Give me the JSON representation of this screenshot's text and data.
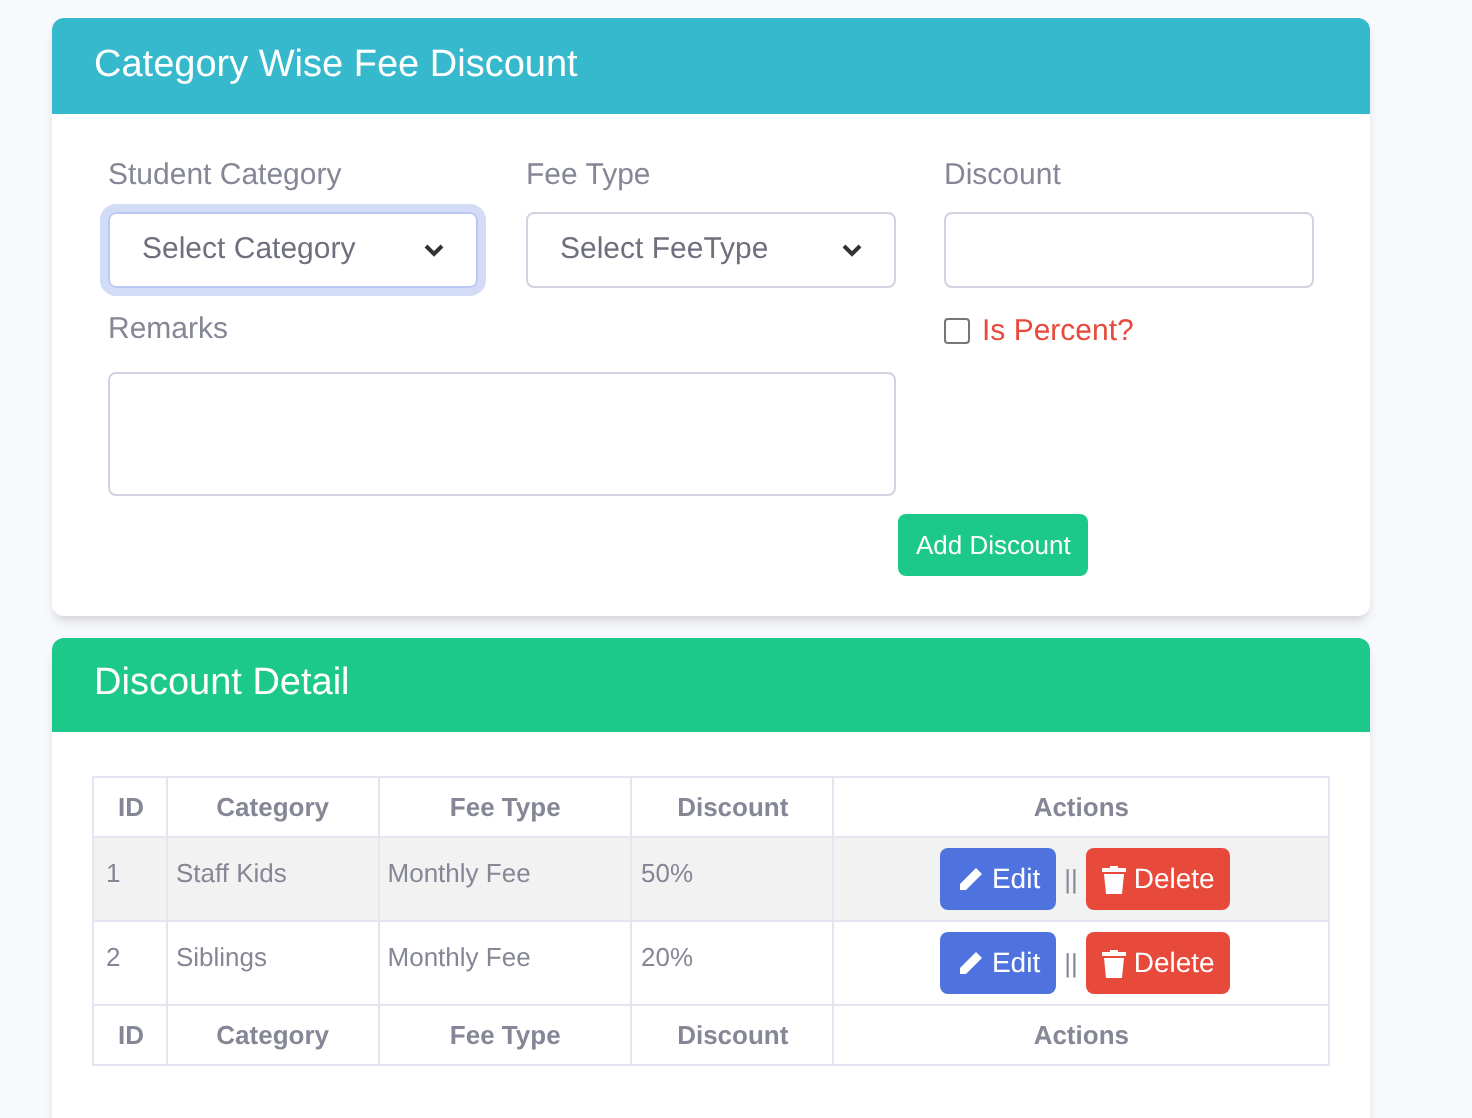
{
  "form_card": {
    "title": "Category Wise Fee Discount",
    "student_category": {
      "label": "Student Category",
      "value": "Select Category",
      "focused": true
    },
    "fee_type": {
      "label": "Fee Type",
      "value": "Select FeeType",
      "focused": false
    },
    "discount": {
      "label": "Discount"
    },
    "is_percent": {
      "label": "Is Percent?",
      "checked": false
    },
    "remarks": {
      "label": "Remarks"
    },
    "add_button": "Add Discount"
  },
  "detail_card": {
    "title": "Discount Detail",
    "table": {
      "columns": [
        "ID",
        "Category",
        "Fee Type",
        "Discount",
        "Actions"
      ],
      "rows": [
        {
          "id": "1",
          "category": "Staff Kids",
          "fee_type": "Monthly Fee",
          "discount": "50%",
          "edit": "Edit",
          "separator": "||",
          "delete": "Delete"
        },
        {
          "id": "2",
          "category": "Siblings",
          "fee_type": "Monthly Fee",
          "discount": "20%",
          "edit": "Edit",
          "separator": "||",
          "delete": "Delete"
        }
      ],
      "footer_columns": [
        "ID",
        "Category",
        "Fee Type",
        "Discount",
        "Actions"
      ]
    }
  }
}
